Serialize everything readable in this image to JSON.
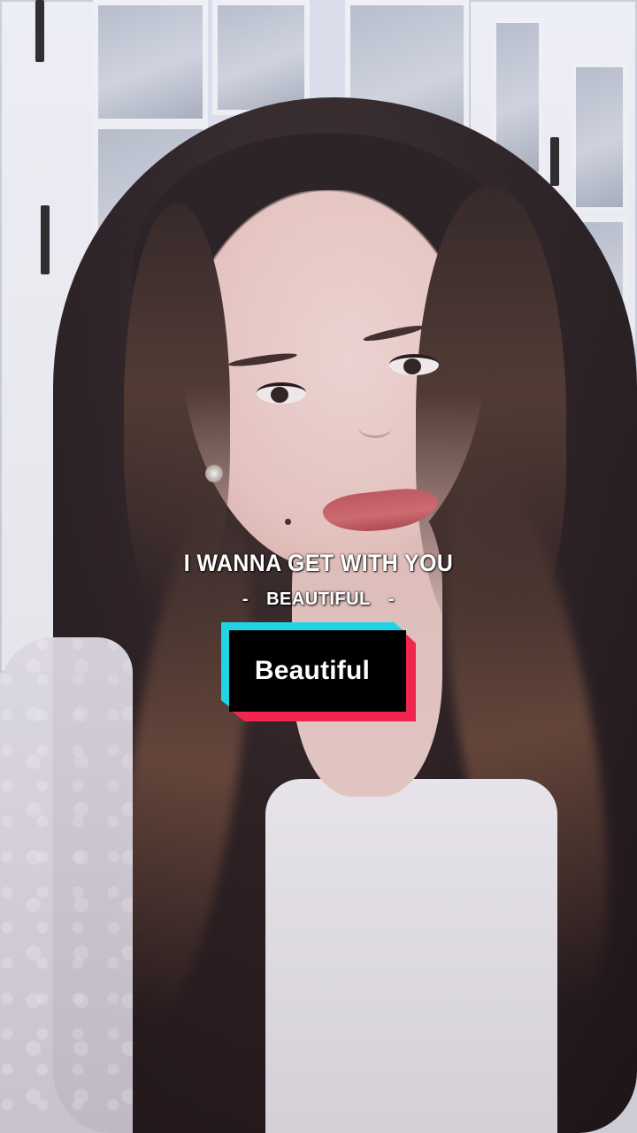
{
  "overlay": {
    "lyric_line": "I WANNA GET WITH YOU",
    "song_title_line": "BEAUTIFUL",
    "dash_left": "-",
    "dash_right": "-",
    "title_card": "Beautiful"
  },
  "colors": {
    "title_card_cyan": "#22d3e6",
    "title_card_red": "#f0264e",
    "title_card_black": "#000000",
    "text_white": "#ffffff"
  }
}
